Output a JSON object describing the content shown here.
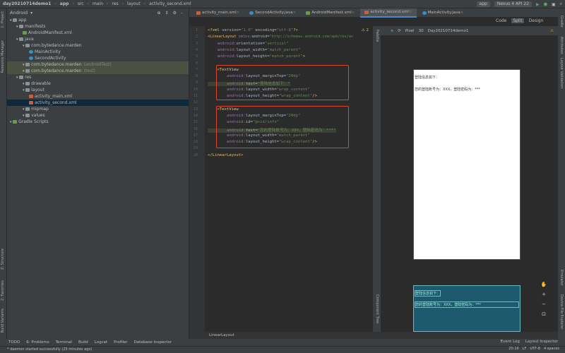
{
  "breadcrumb": [
    "day20210714demo1",
    "app",
    "src",
    "main",
    "res",
    "layout",
    "activity_second.xml"
  ],
  "toolbar": {
    "run_config": "app",
    "device": "Nexus 4 API 22"
  },
  "left_tool_tabs": [
    "1: Project",
    "Resource Manager",
    "Z: Structure",
    "2: Favorites",
    "Build Variants"
  ],
  "right_tool_tabs": [
    "Gradle",
    "Attributes",
    "Layout Validation",
    "Emulator",
    "Device File Explorer"
  ],
  "project": {
    "view": "Android",
    "tree": [
      {
        "label": "app",
        "depth": 0,
        "icon": "folder"
      },
      {
        "label": "manifests",
        "depth": 1,
        "icon": "folder"
      },
      {
        "label": "AndroidManifest.xml",
        "depth": 2,
        "icon": "manifest"
      },
      {
        "label": "java",
        "depth": 1,
        "icon": "folder"
      },
      {
        "label": "com.bytedance.marden",
        "depth": 2,
        "icon": "folder"
      },
      {
        "label": "MainActivity",
        "depth": 3,
        "icon": "class"
      },
      {
        "label": "SecondActivity",
        "depth": 3,
        "icon": "class"
      },
      {
        "label": "com.bytedance.marden",
        "suffix": "(androidTest)",
        "depth": 2,
        "icon": "folder",
        "highlight": true
      },
      {
        "label": "com.bytedance.marden",
        "suffix": "(test)",
        "depth": 2,
        "icon": "folder",
        "highlight": true
      },
      {
        "label": "res",
        "depth": 1,
        "icon": "folder"
      },
      {
        "label": "drawable",
        "depth": 2,
        "icon": "folder"
      },
      {
        "label": "layout",
        "depth": 2,
        "icon": "folder"
      },
      {
        "label": "activity_main.xml",
        "depth": 3,
        "icon": "xml"
      },
      {
        "label": "activity_second.xml",
        "depth": 3,
        "icon": "xml",
        "selected": true
      },
      {
        "label": "mipmap",
        "depth": 2,
        "icon": "folder"
      },
      {
        "label": "values",
        "depth": 2,
        "icon": "folder"
      },
      {
        "label": "Gradle Scripts",
        "depth": 0,
        "icon": "gradle"
      }
    ]
  },
  "editor_tabs": [
    {
      "label": "activity_main.xml",
      "icon": "xml"
    },
    {
      "label": "SecondActivity.java",
      "icon": "class"
    },
    {
      "label": "AndroidManifest.xml",
      "icon": "manifest"
    },
    {
      "label": "activity_second.xml",
      "icon": "xml",
      "active": true
    },
    {
      "label": "MainActivity.java",
      "icon": "class"
    }
  ],
  "view_modes": [
    "Code",
    "Split",
    "Design"
  ],
  "warnings": "2",
  "code_lines": [
    "<?xml version=\"1.0\" encoding=\"utf-8\"?>",
    "<LinearLayout xmlns:android=\"http://schemas.android.com/apk/res/an",
    "    android:orientation=\"vertical\"",
    "    android:layout_width=\"match_parent\"",
    "    android:layout_height=\"match_parent\">",
    "",
    "    <TextView",
    "        android:layout_marginTop=\"20dp\"",
    "        android:text=\"登陆信息如下：\"",
    "        android:layout_width=\"wrap_content\"",
    "        android:layout_height=\"wrap_content\"/>",
    "",
    "    <TextView",
    "        android:layout_marginTop=\"20dp\"",
    "        android:id=\"@+id/info\"",
    "        android:text=\"您的登陆账号为：XXX，登陆密码为：***\"",
    "        android:layout_width=\"match_parent\"",
    "        android:layout_height=\"wrap_content\"/>",
    "",
    "</LinearLayout>"
  ],
  "design_toolbar": {
    "device": "Pixel",
    "api": "30",
    "theme": "Day20210714demo1"
  },
  "preview": {
    "line1": "登陆信息如下：",
    "line2": "您的登陆账号为：XXX，登陆密码为：***"
  },
  "component_tree_label": "Component Tree",
  "palette_label": "Palette",
  "editor_breadcrumb": "LinearLayout",
  "bottom_tools": [
    "TODO",
    "6: Problems",
    "Terminal",
    "Build",
    "Logcat",
    "Profiler",
    "Database Inspector"
  ],
  "bottom_tools_right": [
    "Event Log",
    "Layout Inspector"
  ],
  "status": {
    "message": "* daemon started successfully (25 minutes ago)",
    "position": "20:16",
    "line_sep": "LF",
    "encoding": "UTF-8",
    "indent": "4 spaces"
  }
}
